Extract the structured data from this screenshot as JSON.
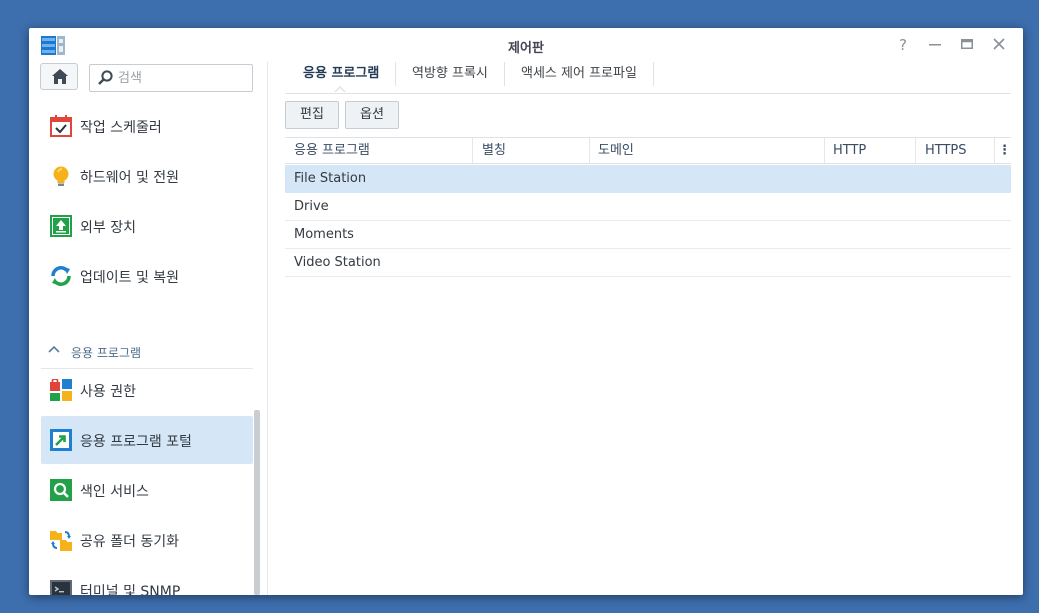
{
  "window": {
    "title": "제어판"
  },
  "sidebar": {
    "search_placeholder": "검색",
    "items_top": [
      {
        "label": "작업 스케줄러",
        "icon": "calendar-check-icon"
      },
      {
        "label": "하드웨어 및 전원",
        "icon": "lightbulb-icon"
      },
      {
        "label": "외부 장치",
        "icon": "external-device-icon"
      },
      {
        "label": "업데이트 및 복원",
        "icon": "update-restore-icon"
      }
    ],
    "section_label": "응용 프로그램",
    "items_apps": [
      {
        "label": "사용 권한",
        "icon": "app-privileges-icon"
      },
      {
        "label": "응용 프로그램 포털",
        "icon": "app-portal-icon",
        "active": true
      },
      {
        "label": "색인 서비스",
        "icon": "indexing-service-icon"
      },
      {
        "label": "공유 폴더 동기화",
        "icon": "shared-folder-sync-icon"
      },
      {
        "label": "터미널 및 SNMP",
        "icon": "terminal-icon"
      }
    ]
  },
  "main": {
    "tabs": [
      {
        "label": "응용 프로그램",
        "active": true
      },
      {
        "label": "역방향 프록시"
      },
      {
        "label": "액세스 제어 프로파일"
      }
    ],
    "toolbar": {
      "edit_label": "편집",
      "options_label": "옵션"
    },
    "table": {
      "columns": [
        "응용 프로그램",
        "별칭",
        "도메인",
        "HTTP",
        "HTTPS"
      ],
      "rows": [
        "File Station",
        "Drive",
        "Moments",
        "Video Station"
      ],
      "selected_row": "File Station"
    }
  },
  "colors": {
    "desktop": "#3d6eae",
    "selection": "#d5e6f6",
    "accent": "#2a7fd4"
  }
}
